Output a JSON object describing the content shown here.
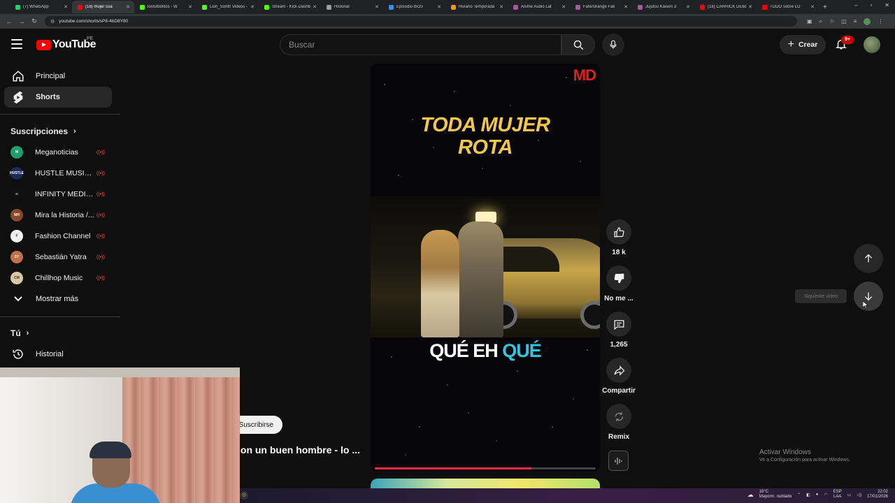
{
  "browser": {
    "tabs": [
      {
        "label": "(7) WhatsApp",
        "color": "#25d366",
        "active": false
      },
      {
        "label": "(18) mujer cua",
        "color": "#ff0000",
        "active": true
      },
      {
        "label": "losfutbolitos - W",
        "color": "#53fc18",
        "active": false
      },
      {
        "label": "Lion_Sonth Videos -",
        "color": "#53fc18",
        "active": false
      },
      {
        "label": "Stream - Kick Dashb",
        "color": "#53fc18",
        "active": false
      },
      {
        "label": "Historial",
        "color": "#9aa0a6",
        "active": false
      },
      {
        "label": "Episodio 8x20 ",
        "color": "#3c8ee8",
        "active": false
      },
      {
        "label": "Horario Temporada",
        "color": "#f29900",
        "active": false
      },
      {
        "label": "Anime Audio Lat",
        "color": "#a35b9c",
        "active": false
      },
      {
        "label": "Fate/strange Fak",
        "color": "#a35b9c",
        "active": false
      },
      {
        "label": "Jujutsu Kaisen 3",
        "color": "#a35b9c",
        "active": false
      },
      {
        "label": "(18) CARRICK DEBE",
        "color": "#ff0000",
        "active": false
      },
      {
        "label": "TODO sobre LO",
        "color": "#ff0000",
        "active": false
      }
    ],
    "url": "youtube.com/shorts/sP8-4bD8Y80"
  },
  "header": {
    "logo_text": "YouTube",
    "country_code": "PE",
    "search_placeholder": "Buscar",
    "create_label": "Crear",
    "notification_count": "9+"
  },
  "sidebar": {
    "main_items": [
      {
        "label": "Principal",
        "icon": "home-icon",
        "active": false
      },
      {
        "label": "Shorts",
        "icon": "shorts-icon",
        "active": true
      }
    ],
    "subscriptions_heading": "Suscripciones",
    "channels": [
      {
        "label": "Meganoticias",
        "avatar_color": "#1f9f6e",
        "avatar_text": "M",
        "live": true
      },
      {
        "label": "HUSTLE MUSIC (...",
        "avatar_color": "#1a2a5a",
        "avatar_text": "HUSTLE",
        "live": true
      },
      {
        "label": "INFINITY MEDIA ...",
        "avatar_color": "#111111",
        "avatar_text": "∞",
        "live": true
      },
      {
        "label": "Mira la Historia /...",
        "avatar_color": "#8a4a2a",
        "avatar_text": "MH",
        "live": true
      },
      {
        "label": "Fashion Channel",
        "avatar_color": "#f1f1f1",
        "avatar_text": "F",
        "live": true
      },
      {
        "label": "Sebastián Yatra",
        "avatar_color": "#c0704a",
        "avatar_text": "SY",
        "live": true
      },
      {
        "label": "Chillhop Music",
        "avatar_color": "#d9c9a0",
        "avatar_text": "CM",
        "live": true
      }
    ],
    "show_more_label": "Mostrar más",
    "you_heading": "Tú",
    "history_label": "Historial"
  },
  "short": {
    "watermark": "MD",
    "headline_line1": "TODA MUJER",
    "headline_line2": "ROTA",
    "caption_prefix": "QUÉ EH ",
    "caption_highlight": "QUÉ",
    "progress_fraction": 0.71,
    "subscribe_label": "Suscribirse",
    "title_text": "on un buen hombre - lo ..."
  },
  "actions": {
    "like_count": "18 k",
    "dislike_label": "No me ...",
    "comment_count": "1,265",
    "share_label": "Compartir",
    "remix_label": "Remix"
  },
  "navigation": {
    "next_tooltip": "Siguiente video"
  },
  "windows": {
    "activate_title": "Activar Windows",
    "activate_sub": "Ve a Configuración para activar Windows.",
    "weather_temp": "18°C",
    "weather_desc": "Mayorm. nublado",
    "lang_top": "ESP",
    "lang_bottom": "LAA",
    "time": "22:02",
    "date": "17/01/2026"
  }
}
